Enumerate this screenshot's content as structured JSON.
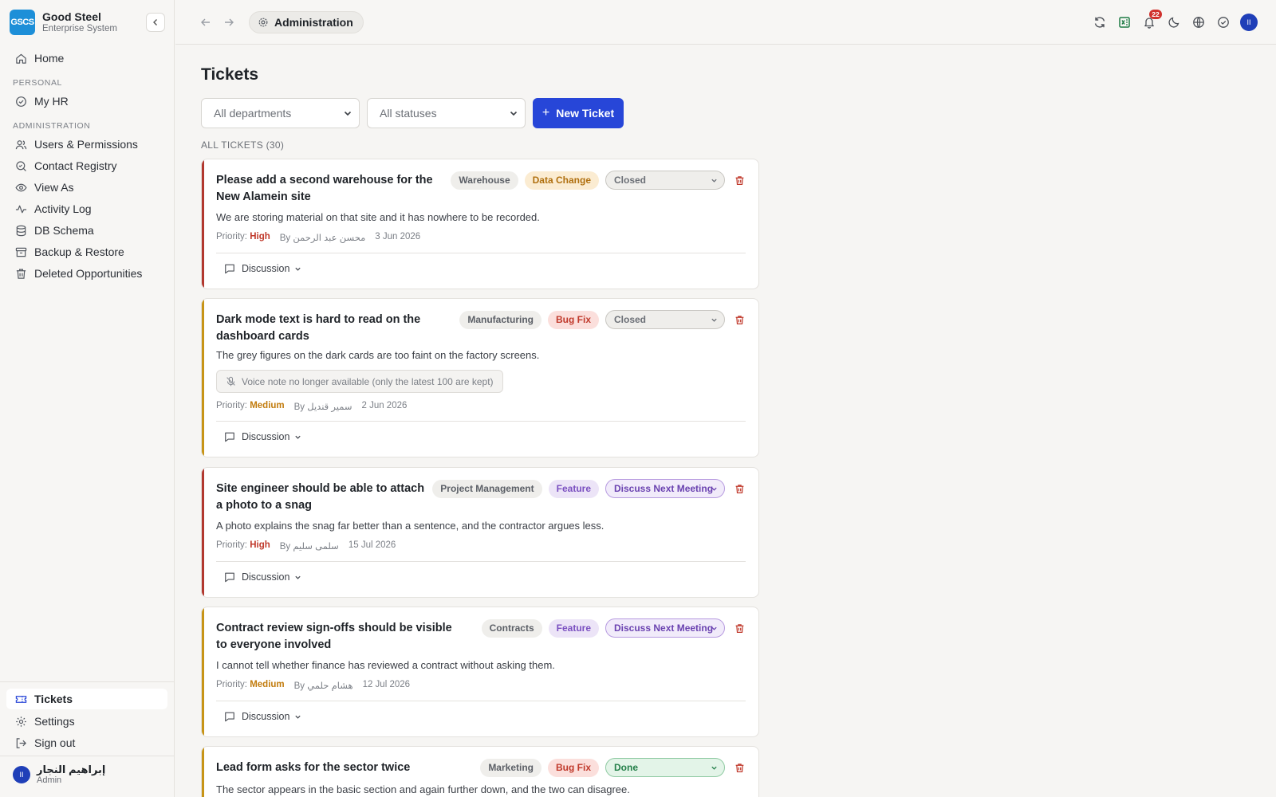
{
  "brand": {
    "logo": "GSCS",
    "name": "Good Steel",
    "subtitle": "Enterprise System"
  },
  "sidebar": {
    "home": "Home",
    "sections": {
      "personal": "PERSONAL",
      "administration": "ADMINISTRATION"
    },
    "personal_items": [
      {
        "label": "My HR",
        "icon": "check-circle-icon"
      }
    ],
    "admin_items": [
      {
        "label": "Users & Permissions",
        "icon": "users-icon"
      },
      {
        "label": "Contact Registry",
        "icon": "search-icon"
      },
      {
        "label": "View As",
        "icon": "eye-icon"
      },
      {
        "label": "Activity Log",
        "icon": "activity-icon"
      },
      {
        "label": "DB Schema",
        "icon": "database-icon"
      },
      {
        "label": "Backup & Restore",
        "icon": "archive-icon"
      },
      {
        "label": "Deleted Opportunities",
        "icon": "trash-icon"
      }
    ],
    "bottom_items": [
      {
        "label": "Tickets",
        "icon": "ticket-icon",
        "active": true
      },
      {
        "label": "Settings",
        "icon": "gear-icon"
      },
      {
        "label": "Sign out",
        "icon": "logout-icon"
      }
    ],
    "user": {
      "avatar": "II",
      "name": "إبراهيم النجار",
      "role": "Admin"
    }
  },
  "topbar": {
    "breadcrumb": "Administration",
    "notification_count": "22",
    "avatar": "II"
  },
  "main": {
    "title": "Tickets",
    "filters": {
      "department": "All departments",
      "status": "All statuses"
    },
    "new_ticket_label": "New Ticket",
    "count_label": "ALL TICKETS (30)"
  },
  "labels": {
    "priority": "Priority:",
    "discussion": "Discussion"
  },
  "colors": {
    "accent": "#2746d8",
    "priority_high": "#c0392b",
    "priority_medium": "#c27c0e",
    "data_change_bg": "#fbecd2",
    "bug_fix_bg": "#fbdfdc",
    "feature_bg": "#ece4f7"
  },
  "tickets": [
    {
      "title": "Please add a second warehouse for the New Alamein site",
      "department": "Warehouse",
      "type": "Data Change",
      "status": "Closed",
      "description": "We are storing material on that site and it has nowhere to be recorded.",
      "priority": "High",
      "by": "By محسن عبد الرحمن",
      "date": "3 Jun 2026"
    },
    {
      "title": "Dark mode text is hard to read on the dashboard cards",
      "department": "Manufacturing",
      "type": "Bug Fix",
      "status": "Closed",
      "description": "The grey figures on the dark cards are too faint on the factory screens.",
      "voice_note": "Voice note no longer available (only the latest 100 are kept)",
      "priority": "Medium",
      "by": "By سمير قنديل",
      "date": "2 Jun 2026"
    },
    {
      "title": "Site engineer should be able to attach a photo to a snag",
      "department": "Project Management",
      "type": "Feature",
      "status": "Discuss Next Meeting",
      "description": "A photo explains the snag far better than a sentence, and the contractor argues less.",
      "priority": "High",
      "by": "By سلمى سليم",
      "date": "15 Jul 2026"
    },
    {
      "title": "Contract review sign-offs should be visible to everyone involved",
      "department": "Contracts",
      "type": "Feature",
      "status": "Discuss Next Meeting",
      "description": "I cannot tell whether finance has reviewed a contract without asking them.",
      "priority": "Medium",
      "by": "By هشام حلمي",
      "date": "12 Jul 2026"
    },
    {
      "title": "Lead form asks for the sector twice",
      "department": "Marketing",
      "type": "Bug Fix",
      "status": "Done",
      "description": "The sector appears in the basic section and again further down, and the two can disagree."
    }
  ]
}
